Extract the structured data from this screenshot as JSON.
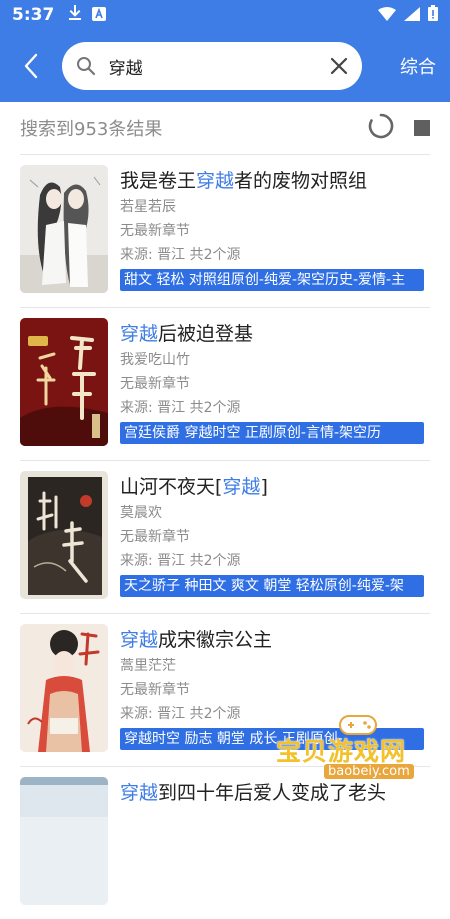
{
  "status": {
    "time": "5:37"
  },
  "search": {
    "query": "穿越",
    "sort_label": "综合"
  },
  "result_bar": {
    "count_text": "搜索到953条结果"
  },
  "books": [
    {
      "title_before": "我是卷王",
      "title_hl": "穿越",
      "title_after": "者的废物对照组",
      "author": "若星若辰",
      "latest": "无最新章节",
      "source": "来源: 晋江  共2个源",
      "tags": "甜文 轻松 对照组原创-纯爱-架空历史-爱情-主"
    },
    {
      "title_before": "",
      "title_hl": "穿越",
      "title_after": "后被迫登基",
      "author": "我爱吃山竹",
      "latest": "无最新章节",
      "source": "来源: 晋江  共2个源",
      "tags": "宫廷侯爵 穿越时空 正剧原创-言情-架空历"
    },
    {
      "title_before": "山河不夜天[",
      "title_hl": "穿越",
      "title_after": "]",
      "author": "莫晨欢",
      "latest": "无最新章节",
      "source": "来源: 晋江  共2个源",
      "tags": "天之骄子 种田文 爽文 朝堂 轻松原创-纯爱-架"
    },
    {
      "title_before": "",
      "title_hl": "穿越",
      "title_after": "成宋徽宗公主",
      "author": "蒿里茫茫",
      "latest": "无最新章节",
      "source": "来源: 晋江  共2个源",
      "tags": "穿越时空 励志 朝堂 成长 正剧原创-"
    },
    {
      "title_before": "",
      "title_hl": "穿越",
      "title_after": "到四十年后爱人变成了老头"
    }
  ],
  "watermark": {
    "text": "宝贝游戏网",
    "url": "baobeiy.com"
  },
  "colors": {
    "primary": "#3f7de6",
    "tag_bg": "#2f6fe3"
  }
}
